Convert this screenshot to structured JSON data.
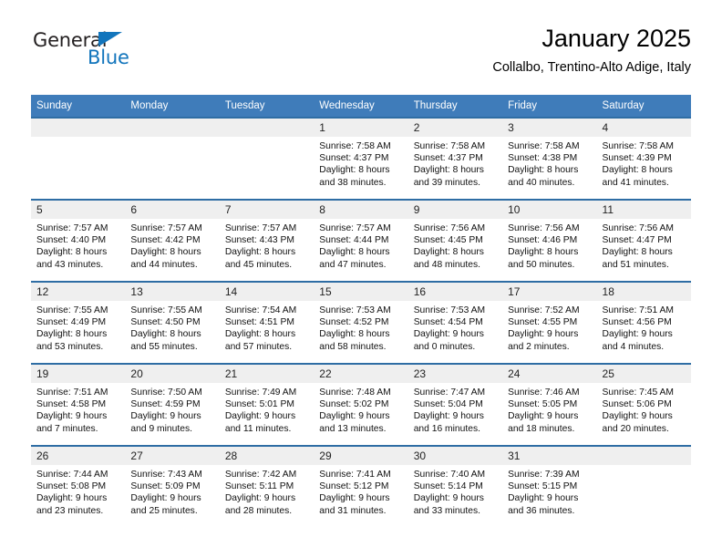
{
  "logo": {
    "word1": "General",
    "word2": "Blue",
    "triangle_color": "#1275bc",
    "word1_color": "#231f20",
    "word2_color": "#1275bc"
  },
  "header": {
    "title": "January 2025",
    "subtitle": "Collalbo, Trentino-Alto Adige, Italy"
  },
  "colors": {
    "header_bar": "#3f7cba",
    "week_divider": "#2e6da4",
    "daynum_strip": "#efefef",
    "page_background": "#ffffff"
  },
  "weekday_headers": [
    "Sunday",
    "Monday",
    "Tuesday",
    "Wednesday",
    "Thursday",
    "Friday",
    "Saturday"
  ],
  "weeks": [
    [
      {
        "day": "",
        "lines": []
      },
      {
        "day": "",
        "lines": []
      },
      {
        "day": "",
        "lines": []
      },
      {
        "day": "1",
        "lines": [
          "Sunrise: 7:58 AM",
          "Sunset: 4:37 PM",
          "Daylight: 8 hours",
          "and 38 minutes."
        ]
      },
      {
        "day": "2",
        "lines": [
          "Sunrise: 7:58 AM",
          "Sunset: 4:37 PM",
          "Daylight: 8 hours",
          "and 39 minutes."
        ]
      },
      {
        "day": "3",
        "lines": [
          "Sunrise: 7:58 AM",
          "Sunset: 4:38 PM",
          "Daylight: 8 hours",
          "and 40 minutes."
        ]
      },
      {
        "day": "4",
        "lines": [
          "Sunrise: 7:58 AM",
          "Sunset: 4:39 PM",
          "Daylight: 8 hours",
          "and 41 minutes."
        ]
      }
    ],
    [
      {
        "day": "5",
        "lines": [
          "Sunrise: 7:57 AM",
          "Sunset: 4:40 PM",
          "Daylight: 8 hours",
          "and 43 minutes."
        ]
      },
      {
        "day": "6",
        "lines": [
          "Sunrise: 7:57 AM",
          "Sunset: 4:42 PM",
          "Daylight: 8 hours",
          "and 44 minutes."
        ]
      },
      {
        "day": "7",
        "lines": [
          "Sunrise: 7:57 AM",
          "Sunset: 4:43 PM",
          "Daylight: 8 hours",
          "and 45 minutes."
        ]
      },
      {
        "day": "8",
        "lines": [
          "Sunrise: 7:57 AM",
          "Sunset: 4:44 PM",
          "Daylight: 8 hours",
          "and 47 minutes."
        ]
      },
      {
        "day": "9",
        "lines": [
          "Sunrise: 7:56 AM",
          "Sunset: 4:45 PM",
          "Daylight: 8 hours",
          "and 48 minutes."
        ]
      },
      {
        "day": "10",
        "lines": [
          "Sunrise: 7:56 AM",
          "Sunset: 4:46 PM",
          "Daylight: 8 hours",
          "and 50 minutes."
        ]
      },
      {
        "day": "11",
        "lines": [
          "Sunrise: 7:56 AM",
          "Sunset: 4:47 PM",
          "Daylight: 8 hours",
          "and 51 minutes."
        ]
      }
    ],
    [
      {
        "day": "12",
        "lines": [
          "Sunrise: 7:55 AM",
          "Sunset: 4:49 PM",
          "Daylight: 8 hours",
          "and 53 minutes."
        ]
      },
      {
        "day": "13",
        "lines": [
          "Sunrise: 7:55 AM",
          "Sunset: 4:50 PM",
          "Daylight: 8 hours",
          "and 55 minutes."
        ]
      },
      {
        "day": "14",
        "lines": [
          "Sunrise: 7:54 AM",
          "Sunset: 4:51 PM",
          "Daylight: 8 hours",
          "and 57 minutes."
        ]
      },
      {
        "day": "15",
        "lines": [
          "Sunrise: 7:53 AM",
          "Sunset: 4:52 PM",
          "Daylight: 8 hours",
          "and 58 minutes."
        ]
      },
      {
        "day": "16",
        "lines": [
          "Sunrise: 7:53 AM",
          "Sunset: 4:54 PM",
          "Daylight: 9 hours",
          "and 0 minutes."
        ]
      },
      {
        "day": "17",
        "lines": [
          "Sunrise: 7:52 AM",
          "Sunset: 4:55 PM",
          "Daylight: 9 hours",
          "and 2 minutes."
        ]
      },
      {
        "day": "18",
        "lines": [
          "Sunrise: 7:51 AM",
          "Sunset: 4:56 PM",
          "Daylight: 9 hours",
          "and 4 minutes."
        ]
      }
    ],
    [
      {
        "day": "19",
        "lines": [
          "Sunrise: 7:51 AM",
          "Sunset: 4:58 PM",
          "Daylight: 9 hours",
          "and 7 minutes."
        ]
      },
      {
        "day": "20",
        "lines": [
          "Sunrise: 7:50 AM",
          "Sunset: 4:59 PM",
          "Daylight: 9 hours",
          "and 9 minutes."
        ]
      },
      {
        "day": "21",
        "lines": [
          "Sunrise: 7:49 AM",
          "Sunset: 5:01 PM",
          "Daylight: 9 hours",
          "and 11 minutes."
        ]
      },
      {
        "day": "22",
        "lines": [
          "Sunrise: 7:48 AM",
          "Sunset: 5:02 PM",
          "Daylight: 9 hours",
          "and 13 minutes."
        ]
      },
      {
        "day": "23",
        "lines": [
          "Sunrise: 7:47 AM",
          "Sunset: 5:04 PM",
          "Daylight: 9 hours",
          "and 16 minutes."
        ]
      },
      {
        "day": "24",
        "lines": [
          "Sunrise: 7:46 AM",
          "Sunset: 5:05 PM",
          "Daylight: 9 hours",
          "and 18 minutes."
        ]
      },
      {
        "day": "25",
        "lines": [
          "Sunrise: 7:45 AM",
          "Sunset: 5:06 PM",
          "Daylight: 9 hours",
          "and 20 minutes."
        ]
      }
    ],
    [
      {
        "day": "26",
        "lines": [
          "Sunrise: 7:44 AM",
          "Sunset: 5:08 PM",
          "Daylight: 9 hours",
          "and 23 minutes."
        ]
      },
      {
        "day": "27",
        "lines": [
          "Sunrise: 7:43 AM",
          "Sunset: 5:09 PM",
          "Daylight: 9 hours",
          "and 25 minutes."
        ]
      },
      {
        "day": "28",
        "lines": [
          "Sunrise: 7:42 AM",
          "Sunset: 5:11 PM",
          "Daylight: 9 hours",
          "and 28 minutes."
        ]
      },
      {
        "day": "29",
        "lines": [
          "Sunrise: 7:41 AM",
          "Sunset: 5:12 PM",
          "Daylight: 9 hours",
          "and 31 minutes."
        ]
      },
      {
        "day": "30",
        "lines": [
          "Sunrise: 7:40 AM",
          "Sunset: 5:14 PM",
          "Daylight: 9 hours",
          "and 33 minutes."
        ]
      },
      {
        "day": "31",
        "lines": [
          "Sunrise: 7:39 AM",
          "Sunset: 5:15 PM",
          "Daylight: 9 hours",
          "and 36 minutes."
        ]
      },
      {
        "day": "",
        "lines": []
      }
    ]
  ]
}
